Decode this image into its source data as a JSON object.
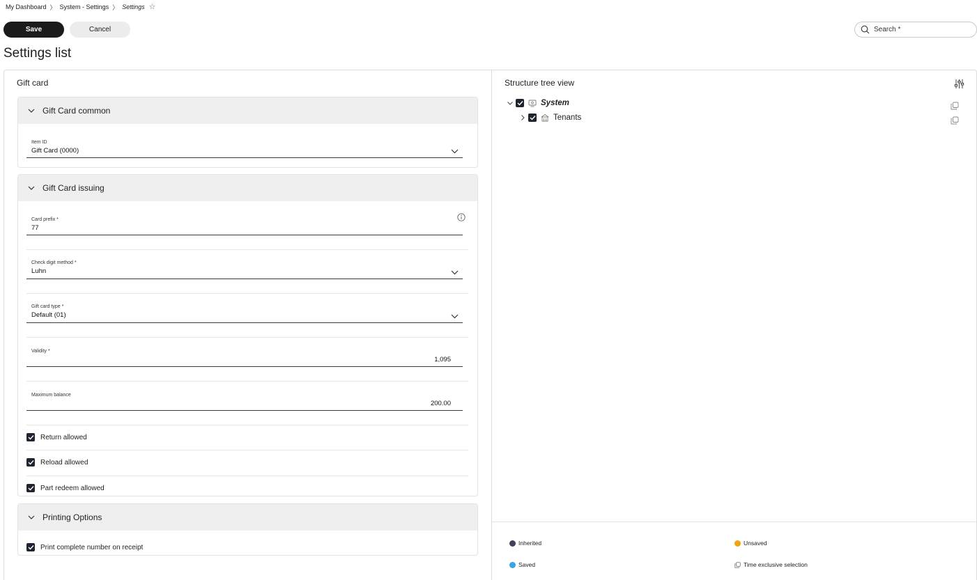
{
  "breadcrumb": {
    "items": [
      "My Dashboard",
      "System - Settings"
    ],
    "current": "Settings",
    "separator": "〉"
  },
  "toolbar": {
    "save_label": "Save",
    "cancel_label": "Cancel",
    "search_placeholder": "Search *"
  },
  "page": {
    "title": "Settings list"
  },
  "left_panel": {
    "title": "Gift card",
    "sections": {
      "common": {
        "title": "Gift Card common",
        "item_id": {
          "label": "Item ID",
          "value": "Gift Card (0000)"
        }
      },
      "issuing": {
        "title": "Gift Card issuing",
        "card_prefix": {
          "label": "Card prefix *",
          "value": "77"
        },
        "check_digit": {
          "label": "Check digit method *",
          "value": "Luhn"
        },
        "card_type": {
          "label": "Gift card type *",
          "value": "Default (01)"
        },
        "validity": {
          "label": "Validity *",
          "value": "1,095"
        },
        "max_balance": {
          "label": "Maximum balance",
          "value": "200.00"
        },
        "return_allowed": {
          "label": "Return allowed",
          "checked": true
        },
        "reload_allowed": {
          "label": "Reload allowed",
          "checked": true
        },
        "part_redeem": {
          "label": "Part redeem allowed",
          "checked": true
        }
      },
      "printing": {
        "title": "Printing Options",
        "print_complete": {
          "label": "Print complete number on receipt",
          "checked": true
        }
      }
    }
  },
  "right_panel": {
    "title": "Structure tree view",
    "tree": {
      "system": {
        "label": "System",
        "checked": true,
        "expanded": true,
        "icon": "system-icon"
      },
      "tenants": {
        "label": "Tenants",
        "checked": true,
        "expanded": false,
        "icon": "tenants-icon"
      }
    },
    "legend": {
      "inherited": {
        "label": "Inherited",
        "color": "#3d4257"
      },
      "unsaved": {
        "label": "Unsaved",
        "color": "#f0a30a"
      },
      "saved": {
        "label": "Saved",
        "color": "#3aa3e3"
      },
      "time_exclusive": {
        "label": "Time exclusive selection",
        "icon": "copy-icon"
      }
    }
  },
  "colors": {
    "primary": "#1b1b1b",
    "section_header": "#efefef",
    "checkbox": "#1f2430"
  }
}
